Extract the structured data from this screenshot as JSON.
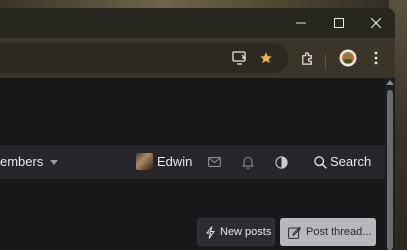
{
  "browser": {
    "window_controls": [
      "minimize",
      "maximize",
      "close"
    ],
    "toolbar_icons": [
      "install-app-icon",
      "bookmark-star-icon",
      "extensions-icon",
      "profile-avatar",
      "menu-dots-icon"
    ]
  },
  "forum": {
    "nav": {
      "members_label": "embers",
      "username": "Edwin",
      "search_label": "Search"
    },
    "actions": {
      "new_posts_label": "New posts",
      "post_thread_label": "Post thread..."
    }
  },
  "colors": {
    "bookmark_star": "#f1b434",
    "post_thread_bg": "#b6b8bc",
    "navbar_bg": "#26272b"
  }
}
